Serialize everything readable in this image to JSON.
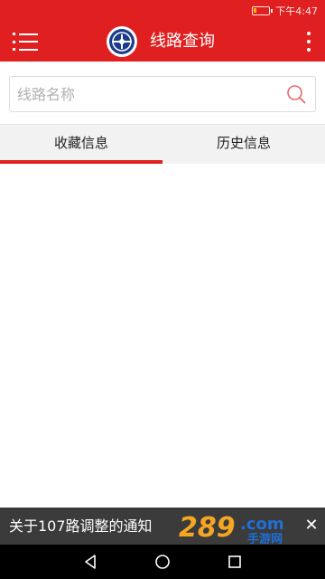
{
  "status_bar": {
    "time": "下午4:47",
    "battery_level": 0.2
  },
  "app_bar": {
    "title": "线路查询",
    "menu_icon": "menu-icon",
    "more_icon": "more-vert-icon"
  },
  "search": {
    "placeholder": "线路名称",
    "value": "",
    "icon": "search-icon"
  },
  "tabs": [
    {
      "label": "收藏信息",
      "active": true
    },
    {
      "label": "历史信息",
      "active": false
    }
  ],
  "notice": {
    "text": "关于107路调整的通知",
    "watermark": "289.com 手游网",
    "close_icon": "close-icon"
  },
  "nav_bar": {
    "back_icon": "back-icon",
    "home_icon": "home-icon",
    "recents_icon": "recents-icon"
  },
  "colors": {
    "primary": "#e02020",
    "tab_background": "#f2f2f2",
    "notice_background": "#3b3b3b",
    "watermark_orange": "#f5a623",
    "watermark_blue": "#1e6fd9"
  }
}
